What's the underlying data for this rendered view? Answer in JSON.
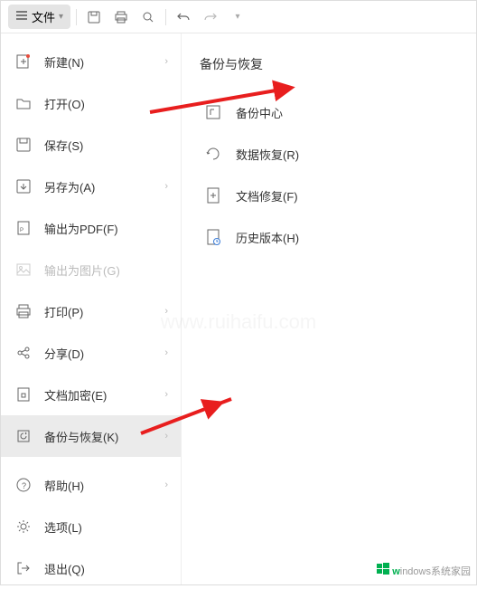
{
  "toolbar": {
    "file_label": "文件"
  },
  "menu": {
    "items": [
      {
        "label": "新建(N)",
        "arrow": true
      },
      {
        "label": "打开(O)",
        "arrow": false
      },
      {
        "label": "保存(S)",
        "arrow": false
      },
      {
        "label": "另存为(A)",
        "arrow": true
      },
      {
        "label": "输出为PDF(F)",
        "arrow": false
      },
      {
        "label": "输出为图片(G)",
        "arrow": false,
        "disabled": true
      },
      {
        "label": "打印(P)",
        "arrow": true
      },
      {
        "label": "分享(D)",
        "arrow": true
      },
      {
        "label": "文档加密(E)",
        "arrow": true
      },
      {
        "label": "备份与恢复(K)",
        "arrow": true,
        "selected": true
      },
      {
        "label": "帮助(H)",
        "arrow": true
      },
      {
        "label": "选项(L)",
        "arrow": false
      },
      {
        "label": "退出(Q)",
        "arrow": false
      }
    ]
  },
  "panel": {
    "title": "备份与恢复",
    "items": [
      {
        "label": "备份中心"
      },
      {
        "label": "数据恢复(R)"
      },
      {
        "label": "文档修复(F)"
      },
      {
        "label": "历史版本(H)"
      }
    ]
  },
  "watermark": {
    "brand_w": "w",
    "brand_rest": "indows",
    "text": "系统家园",
    "url": "www.ruihaifu.com"
  }
}
